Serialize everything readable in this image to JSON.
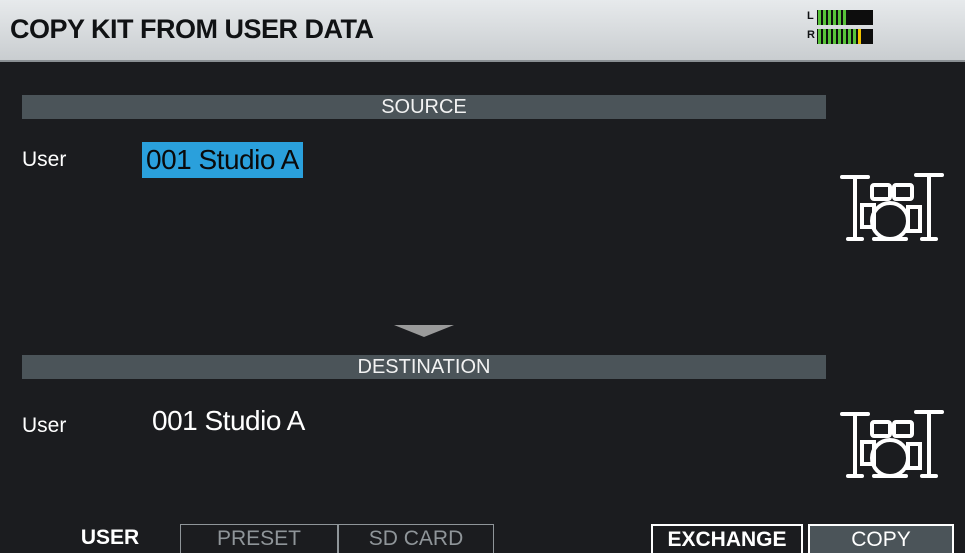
{
  "header": {
    "title": "COPY KIT FROM USER DATA",
    "meter_left_label": "L",
    "meter_right_label": "R",
    "meter_left_level": 0.55,
    "meter_right_level": 0.82
  },
  "source": {
    "section_label": "SOURCE",
    "bank_label": "User",
    "kit_name": "001 Studio A",
    "kit_icon": "drum-kit-icon"
  },
  "destination": {
    "section_label": "DESTINATION",
    "bank_label": "User",
    "kit_name": "001 Studio A",
    "kit_icon": "drum-kit-icon"
  },
  "function_keys": {
    "user": "USER",
    "preset": "PRESET",
    "sd_card": "SD CARD",
    "exchange": "EXCHANGE",
    "copy": "COPY"
  },
  "colors": {
    "selection": "#2aa0dc",
    "section_bar": "#4b5459",
    "background": "#1b1c1f"
  }
}
